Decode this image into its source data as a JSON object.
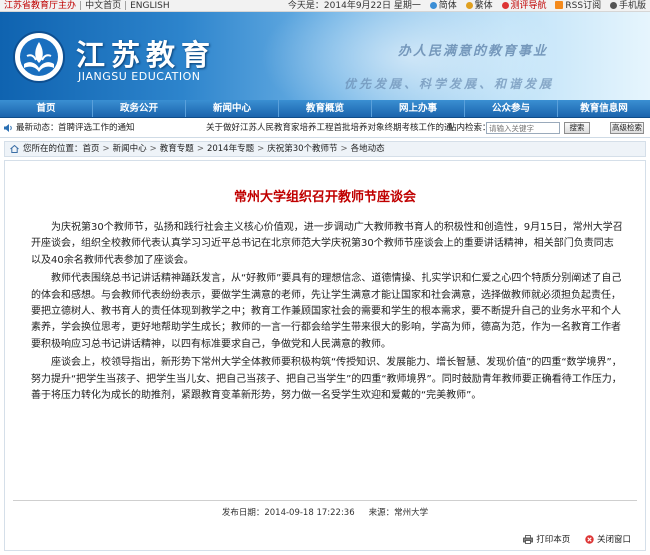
{
  "topbar": {
    "site_name": "江苏省教育厅主办",
    "link_cn": "中文首页",
    "link_en": "ENGLISH",
    "date_text": "今天是：2014年9月22日 星期一",
    "link_simplified": "简体",
    "link_traditional": "繁体",
    "link_test": "测评导航",
    "link_rss": "RSS订阅",
    "link_mobile": "手机版"
  },
  "banner": {
    "title": "江苏教育",
    "subtitle": "JIANGSU EDUCATION",
    "slogan_top": "办人民满意的教育事业",
    "slogan_bottom": "优先发展、科学发展、和谐发展"
  },
  "nav": {
    "items": [
      "首页",
      "政务公开",
      "新闻中心",
      "教育概览",
      "网上办事",
      "公众参与",
      "教育信息网"
    ]
  },
  "ticker": {
    "label": "最新动态：",
    "item1": "首聘评选工作的通知",
    "item2": "关于做好江苏人民教育家培养工程首批培养对象终期考核工作的通",
    "site_in": "站内检索：",
    "search_placeholder": "请输入关键字",
    "search_button": "搜索",
    "advanced_button": "高级检索"
  },
  "breadcrumb": {
    "prefix": "您所在的位置：",
    "items": [
      "首页",
      "新闻中心",
      "教育专题",
      "2014年专题",
      "庆祝第30个教师节",
      "各地动态"
    ]
  },
  "article": {
    "title": "常州大学组织召开教师节座谈会",
    "paragraphs": [
      "为庆祝第30个教师节，弘扬和践行社会主义核心价值观，进一步调动广大教师教书育人的积极性和创造性，9月15日，常州大学召开座谈会，组织全校教师代表认真学习习近平总书记在北京师范大学庆祝第30个教师节座谈会上的重要讲话精神，相关部门负责同志以及40余名教师代表参加了座谈会。",
      "教师代表围绕总书记讲话精神踊跃发言，从“好教师”要具有的理想信念、道德情操、扎实学识和仁爱之心四个特质分别阐述了自己的体会和感想。与会教师代表纷纷表示，要做学生满意的老师，先让学生满意才能让国家和社会满意，选择做教师就必须担负起责任，要把立德树人、教书育人的责任体现到教学之中；教育工作兼顾国家社会的需要和学生的根本需求，要不断提升自己的业务水平和个人素养，学会换位思考，更好地帮助学生成长；教师的一言一行都会给学生带来很大的影响，学高为师，德高为范，作为一名教育工作者要积极响应习总书记讲话精神，以四有标准要求自己，争做党和人民满意的教师。",
      "座谈会上，校领导指出，新形势下常州大学全体教师要积极构筑“传授知识、发展能力、增长智慧、发现价值”的四重“数学境界”，努力提升“把学生当孩子、把学生当儿女、把自己当孩子、把自己当学生”的四重“教师境界”。同时鼓励青年教师要正确看待工作压力，善于将压力转化为成长的助推剂，紧跟教育变革新形势，努力做一名受学生欢迎和爱戴的“完美教师”。"
    ],
    "publish_label": "发布日期：",
    "publish_date": "2014-09-18 17:22:36",
    "source_label": "来源：",
    "source": "常州大学",
    "print_label": "打印本页",
    "close_label": "关闭窗口"
  },
  "colors": {
    "nav_blue": "#1b64ad",
    "title_red": "#c00000",
    "banner_blue": "#0f63b0"
  }
}
